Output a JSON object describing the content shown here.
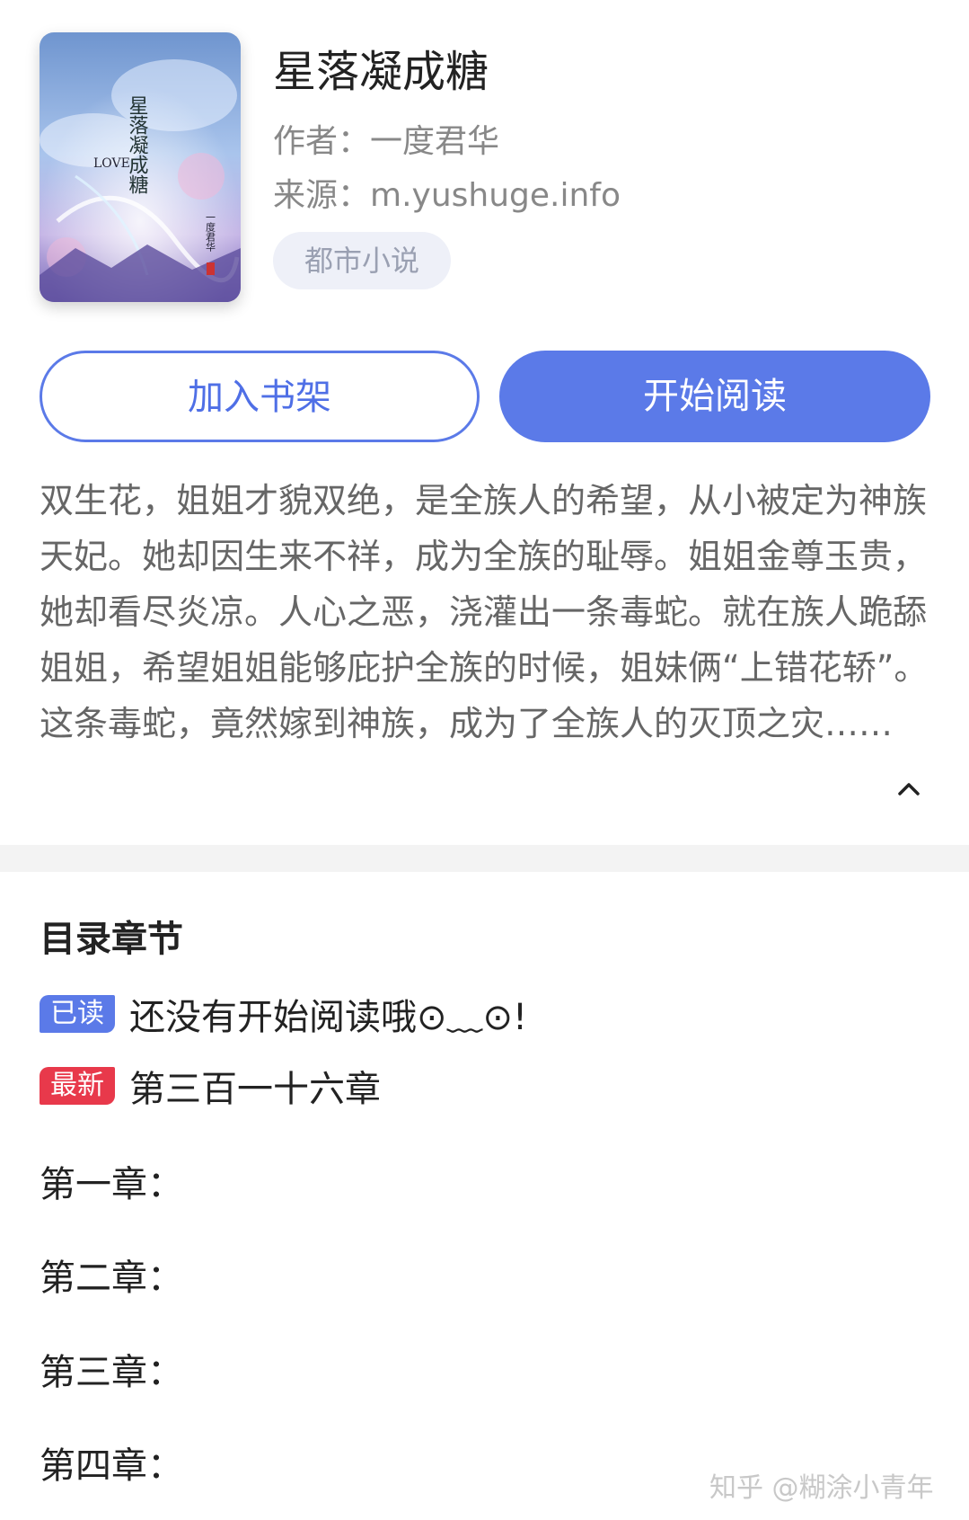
{
  "book": {
    "title": "星落凝成糖",
    "author_line": "作者：一度君华",
    "source_line": "来源：m.yushuge.info",
    "tag": "都市小说"
  },
  "cover": {
    "vertical_title": "星落凝成糖",
    "english_title": "LOVE",
    "vertical_author": "一度君华"
  },
  "actions": {
    "add_shelf_label": "加入书架",
    "start_reading_label": "开始阅读",
    "accent_color": "#5b7ae8"
  },
  "description": {
    "text": "双生花，姐姐才貌双绝，是全族人的希望，从小被定为神族天妃。她却因生来不祥，成为全族的耻辱。姐姐金尊玉贵，她却看尽炎凉。人心之恶，浇灌出一条毒蛇。就在族人跪舔姐姐，希望姐姐能够庇护全族的时候，姐妹俩“上错花轿”。这条毒蛇，竟然嫁到神族，成为了全族人的灭顶之灾……",
    "collapse_icon": "chevron-up-icon"
  },
  "toc": {
    "title": "目录章节",
    "read_badge": "已读",
    "read_status": "还没有开始阅读哦⊙﹏⊙!",
    "latest_badge": "最新",
    "latest_chapter": "第三百一十六章",
    "read_badge_color": "#5b7ae8",
    "latest_badge_color": "#e8394b",
    "chapters": [
      "第一章：",
      "第二章：",
      "第三章：",
      "第四章："
    ]
  },
  "watermark": "知乎 @糊涂小青年"
}
